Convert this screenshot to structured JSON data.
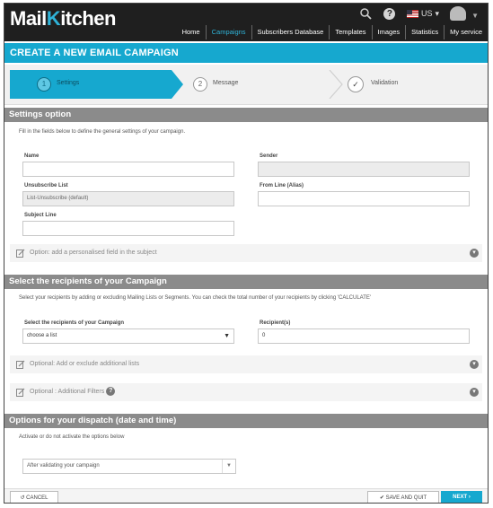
{
  "brand": {
    "logo_prefix": "Mail",
    "logo_k": "K",
    "logo_suffix": "itchen"
  },
  "topbar": {
    "language": "US"
  },
  "nav": [
    "Home",
    "Campaigns",
    "Subscribers Database",
    "Templates",
    "Images",
    "Statistics",
    "My service"
  ],
  "page_title": "CREATE A NEW EMAIL CAMPAIGN",
  "steps": [
    {
      "num": "1",
      "label": "Settings"
    },
    {
      "num": "2",
      "label": "Message"
    },
    {
      "num": "✓",
      "label": "Validation"
    }
  ],
  "settings": {
    "header": "Settings option",
    "intro": "Fill in the fields below to define the general settings of your campaign.",
    "name_label": "Name",
    "name_value": "",
    "sender_label": "Sender",
    "sender_value": "",
    "unsub_label": "Unsubscribe List",
    "unsub_value": "List-Unsubscribe (default)",
    "from_label": "From Line (Alias)",
    "from_value": "",
    "subject_label": "Subject Line",
    "subject_value": "",
    "option_personalised": "Option: add a personalised field in the subject"
  },
  "recipients": {
    "header": "Select the recipients of your Campaign",
    "intro": "Select your recipients by adding or excluding Mailing Lists or Segments. You can check the total number of your recipients by clicking 'CALCULATE'",
    "select_label": "Select the recipients of your Campaign",
    "select_value": "choose a list",
    "count_label": "Recipient(s)",
    "count_value": "0",
    "opt_lists": "Optional: Add or exclude additional lists",
    "opt_filters": "Optional : Additional Filters"
  },
  "dispatch": {
    "header": "Options for your dispatch (date and time)",
    "intro": "Activate or do not activate the options below",
    "select_value": "After validating your campaign"
  },
  "footer": {
    "cancel": "CANCEL",
    "save": "SAVE AND QUIT",
    "next": "NEXT"
  }
}
